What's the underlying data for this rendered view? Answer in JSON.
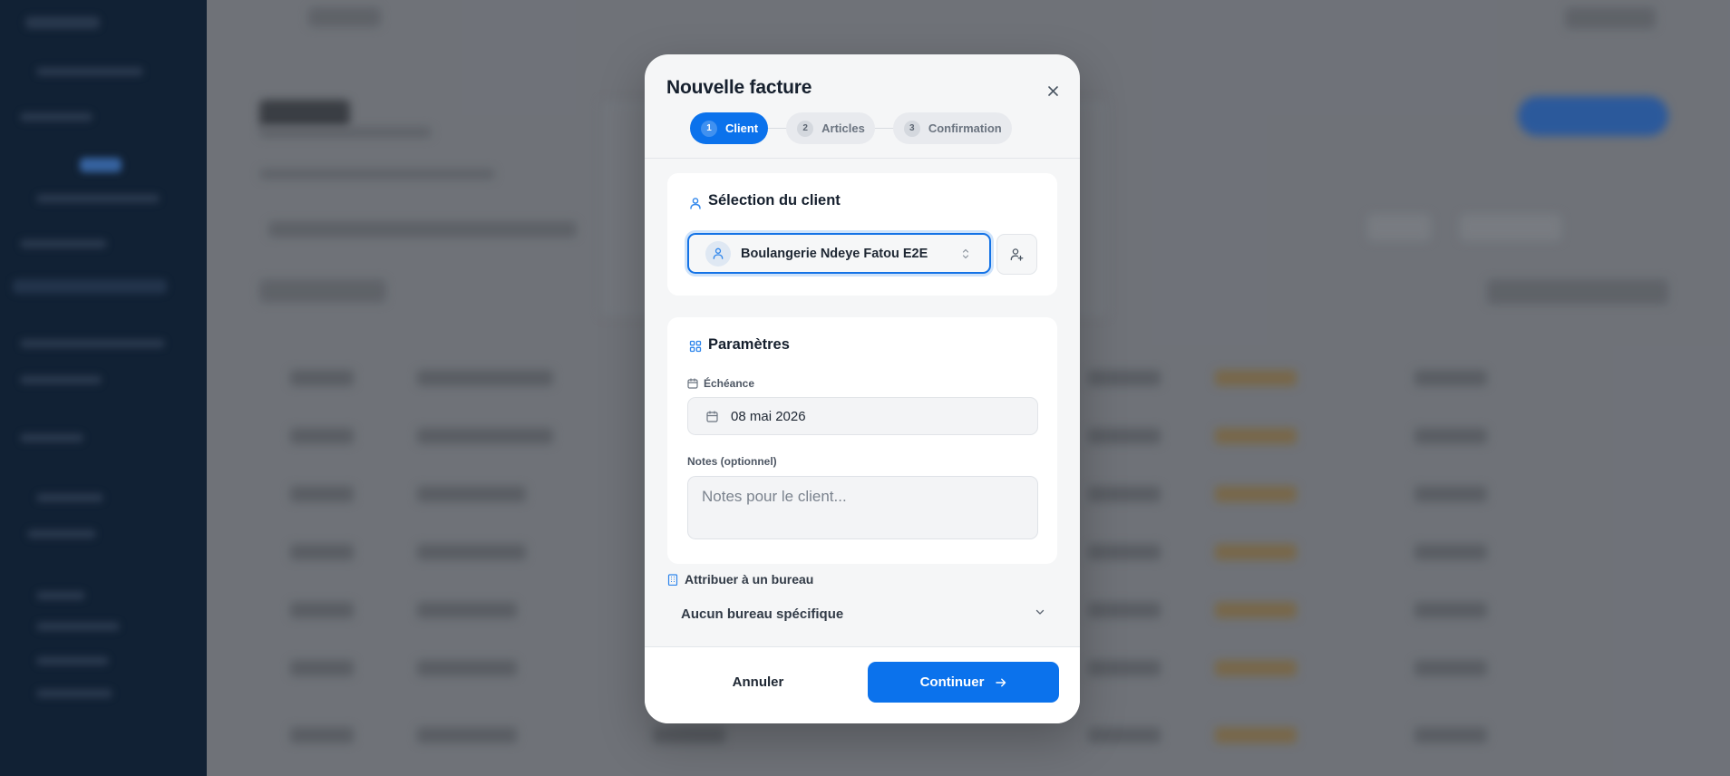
{
  "modal": {
    "title": "Nouvelle facture",
    "close_icon": "close-icon",
    "steps": [
      {
        "number": "1",
        "label": "Client",
        "state": "active"
      },
      {
        "number": "2",
        "label": "Articles",
        "state": "inactive"
      },
      {
        "number": "3",
        "label": "Confirmation",
        "state": "inactive"
      }
    ],
    "client_section": {
      "title": "Sélection du client",
      "icon": "user-icon",
      "selected_client": "Boulangerie Ndeye Fatou E2E",
      "add_client_icon": "user-plus-icon"
    },
    "params_section": {
      "title": "Paramètres",
      "icon": "sliders-icon",
      "due_label": "Échéance",
      "due_value": "08 mai 2026",
      "notes_label": "Notes (optionnel)",
      "notes_placeholder": "Notes pour le client...",
      "notes_value": ""
    },
    "office": {
      "label": "Attribuer à un bureau",
      "icon": "building-icon",
      "selected": "Aucun bureau spécifique"
    },
    "footer": {
      "cancel_label": "Annuler",
      "continue_label": "Continuer",
      "continue_icon": "arrow-right-icon"
    }
  },
  "colors": {
    "accent": "#0b72ec",
    "sidebar_bg": "#0d1f35",
    "overlay": "#7f8288"
  }
}
